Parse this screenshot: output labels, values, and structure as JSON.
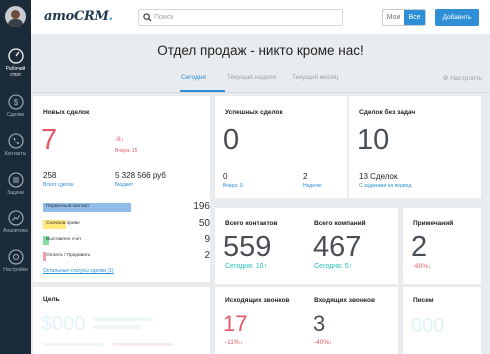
{
  "sidebar": {
    "items": [
      {
        "label": "Рабочий стол",
        "icon": "dashboard-icon",
        "active": true
      },
      {
        "label": "Сделки",
        "icon": "dollar-icon",
        "active": false
      },
      {
        "label": "Контакты",
        "icon": "phone-icon",
        "active": false
      },
      {
        "label": "Задачи",
        "icon": "tasks-list-icon",
        "active": false
      },
      {
        "label": "Аналитика",
        "icon": "analytics-icon",
        "active": false
      },
      {
        "label": "Настройки",
        "icon": "gear-icon",
        "active": false
      }
    ]
  },
  "topbar": {
    "logo_main": "amoCRM",
    "logo_dot": ".",
    "search_placeholder": "Поиск",
    "scope_mine": "Мои",
    "scope_all": "Все",
    "add_button": "Добавить"
  },
  "header": {
    "title": "Отдел продаж - никто кроме нас!",
    "tabs": [
      "Сегодня",
      "Текущая неделя",
      "Текущий месяц"
    ],
    "settings": "Настроить"
  },
  "new_deals": {
    "title": "Новых сделок",
    "value": "7",
    "delta": "-8↓",
    "yesterday": "Вчера: 15",
    "total_value": "258",
    "total_caption": "Всего сделок",
    "budget_value": "5 328 566 руб",
    "budget_caption": "Бюджет",
    "stages": [
      {
        "label": "Первичный контакт",
        "value": "196",
        "color": "#8fbde9",
        "fill": 0.73
      },
      {
        "label": "Сначала приве",
        "value": "50",
        "color": "#ffe97a",
        "fill": 0.19
      },
      {
        "label": "Выставлен счет",
        "value": "9",
        "color": "#7fe1a0",
        "fill": 0.05
      },
      {
        "label": "Оплата / Продавать",
        "value": "2",
        "color": "#f4a0a8",
        "fill": 0.02
      }
    ],
    "other_link": "Остальные статусы сделки (1)"
  },
  "won_deals": {
    "title": "Успешных сделок",
    "value": "0",
    "left_value": "0",
    "left_caption": "Вчера: 0",
    "right_value": "2",
    "right_caption": "Неделю"
  },
  "no_tasks": {
    "title": "Сделок без задач",
    "value": "10",
    "count_text": "13 Сделок",
    "caption": "С задачами на период"
  },
  "contacts": {
    "title": "Всего контактов",
    "value": "559",
    "today": "Сегодня: 10↑"
  },
  "companies": {
    "title": "Всего компаний",
    "value": "467",
    "today": "Сегодня: 5↑"
  },
  "notes": {
    "title": "Примечаний",
    "value": "2",
    "delta": "-60%↓"
  },
  "goal": {
    "title": "Цель",
    "faded_value": "$000"
  },
  "outgoing": {
    "title": "Исходящих звонков",
    "value": "17",
    "delta": "-11%↓"
  },
  "incoming": {
    "title": "Входящих звонков",
    "value": "3",
    "delta": "-40%↓"
  },
  "letters": {
    "title": "Писем",
    "faded_value": "000"
  },
  "colors": {
    "accent": "#2e8fd6",
    "sidebar": "#1b2b3a",
    "red": "#e25866",
    "teal": "#25c0b6"
  }
}
